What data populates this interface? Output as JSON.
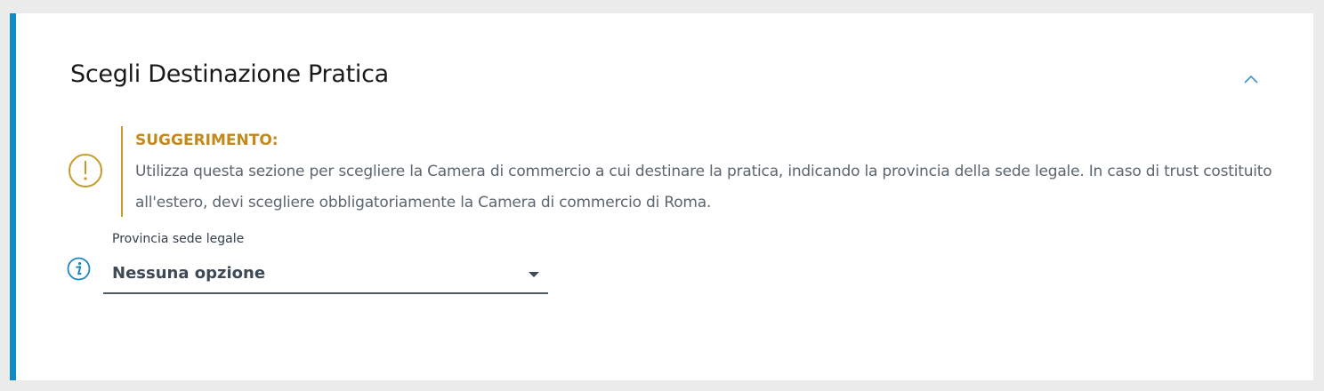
{
  "section": {
    "title": "Scegli Destinazione Pratica",
    "collapse_icon": "chevron-up-icon"
  },
  "hint": {
    "icon": "exclamation-circle-icon",
    "title": "SUGGERIMENTO:",
    "text": "Utilizza questa sezione per scegliere la Camera di commercio a cui destinare la pratica, indicando la provincia della sede legale. In caso di trust costituito all'estero, devi scegliere obbligatoriamente la Camera di commercio di Roma."
  },
  "field": {
    "info_icon": "info-icon",
    "label": "Provincia sede legale",
    "value": "Nessuna opzione",
    "dropdown_icon": "caret-down-icon"
  },
  "colors": {
    "accent": "#0f8bc6",
    "warning": "#c4891a",
    "text": "#5b6670"
  }
}
